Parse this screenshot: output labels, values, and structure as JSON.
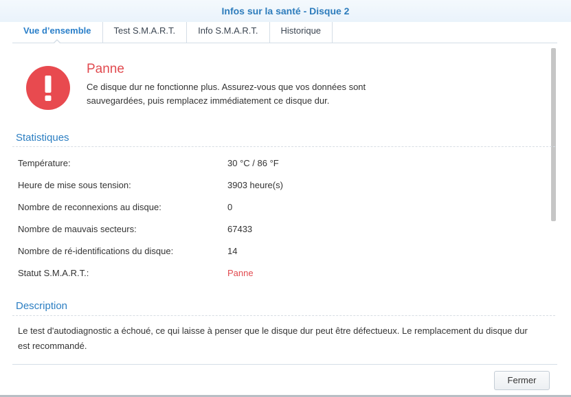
{
  "window": {
    "title": "Infos sur la santé - Disque 2"
  },
  "tabs": [
    {
      "label": "Vue d’ensemble",
      "active": true
    },
    {
      "label": "Test S.M.A.R.T.",
      "active": false
    },
    {
      "label": "Info S.M.A.R.T.",
      "active": false
    },
    {
      "label": "Historique",
      "active": false
    }
  ],
  "status": {
    "icon": "exclamation-icon",
    "title": "Panne",
    "description": "Ce disque dur ne fonctionne plus. Assurez-vous que vos données sont sauvegardées, puis remplacez immédiatement ce disque dur.",
    "color": "#e14a4f"
  },
  "statistics": {
    "heading": "Statistiques",
    "rows": [
      {
        "label": "Température:",
        "value": "30 °C / 86 °F"
      },
      {
        "label": "Heure de mise sous tension:",
        "value": "3903 heure(s)"
      },
      {
        "label": "Nombre de reconnexions au disque:",
        "value": "0"
      },
      {
        "label": "Nombre de mauvais secteurs:",
        "value": "67433"
      },
      {
        "label": "Nombre de ré-identifications du disque:",
        "value": "14"
      },
      {
        "label": "Statut S.M.A.R.T.:",
        "value": "Panne"
      }
    ]
  },
  "description": {
    "heading": "Description",
    "text": "Le test d'autodiagnostic a échoué, ce qui laisse à penser que le disque dur peut être défectueux. Le remplacement du disque dur est recommandé."
  },
  "footer": {
    "close_label": "Fermer"
  },
  "colors": {
    "accent": "#2b7ec2",
    "danger": "#e14a4f"
  }
}
